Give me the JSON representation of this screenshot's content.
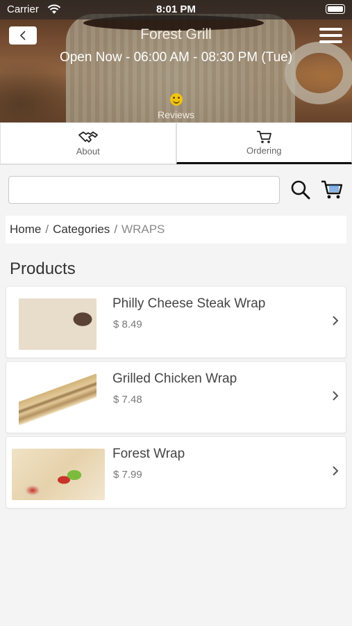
{
  "status_bar": {
    "carrier": "Carrier",
    "time": "8:01 PM"
  },
  "header": {
    "title": "Forest Grill",
    "hours": "Open Now - 06:00 AM - 08:30 PM (Tue)",
    "reviews_label": "Reviews"
  },
  "tabs": [
    {
      "label": "About",
      "icon": "handshake-icon",
      "active": false
    },
    {
      "label": "Ordering",
      "icon": "cart-icon",
      "active": true
    }
  ],
  "search": {
    "value": "",
    "placeholder": ""
  },
  "breadcrumb": {
    "home": "Home",
    "categories": "Categories",
    "current": "WRAPS",
    "separator": "/"
  },
  "section_title": "Products",
  "products": [
    {
      "name": "Philly Cheese Steak Wrap",
      "price": "$ 8.49"
    },
    {
      "name": "Grilled Chicken Wrap",
      "price": "$ 7.48"
    },
    {
      "name": "Forest Wrap",
      "price": "$ 7.99"
    }
  ],
  "colors": {
    "active_tab_underline": "#111111",
    "background": "#f4f4f4",
    "smiley": "#f1c40f"
  }
}
